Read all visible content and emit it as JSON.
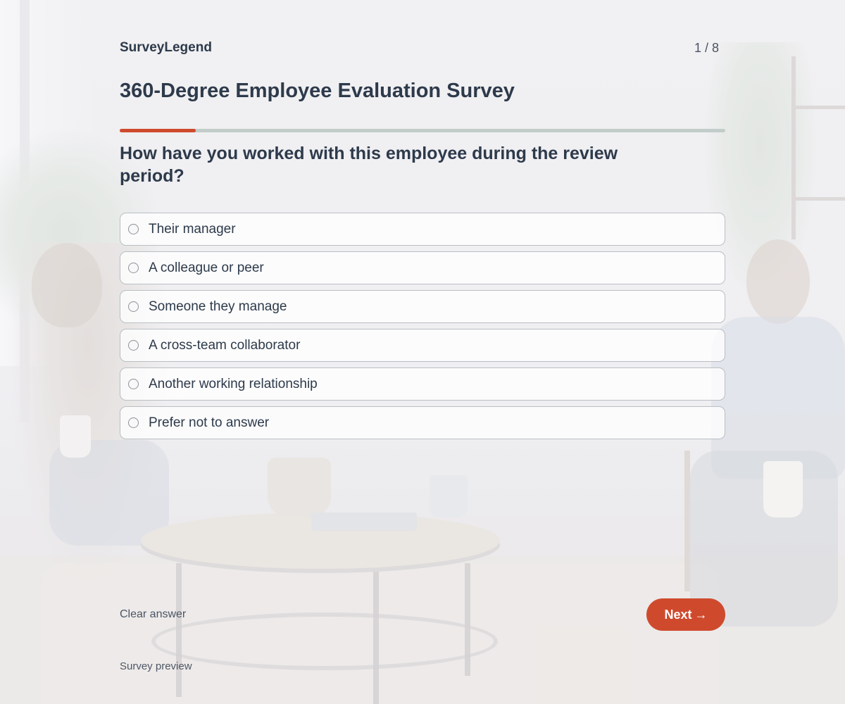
{
  "brand": "SurveyLegend",
  "progress": {
    "counter": "1 / 8",
    "current_step": 1,
    "total_steps": 8,
    "fill_fraction": 0.125
  },
  "survey": {
    "title": "360-Degree Employee Evaluation Survey"
  },
  "question": {
    "text": "How have you worked with this employee during the review period?",
    "options": [
      {
        "label": "Their manager",
        "selected": false
      },
      {
        "label": "A colleague or peer",
        "selected": false
      },
      {
        "label": "Someone they manage",
        "selected": false
      },
      {
        "label": "A cross-team collaborator",
        "selected": false
      },
      {
        "label": "Another working relationship",
        "selected": false
      },
      {
        "label": "Prefer not to answer",
        "selected": false
      }
    ]
  },
  "actions": {
    "clear_label": "Clear answer",
    "next_label": "Next",
    "next_arrow": "→"
  },
  "footer": {
    "text": "Survey preview"
  },
  "colors": {
    "accent": "#cf4a2d",
    "text": "#2d3a4b",
    "progress_track": "#c2ccc8"
  }
}
